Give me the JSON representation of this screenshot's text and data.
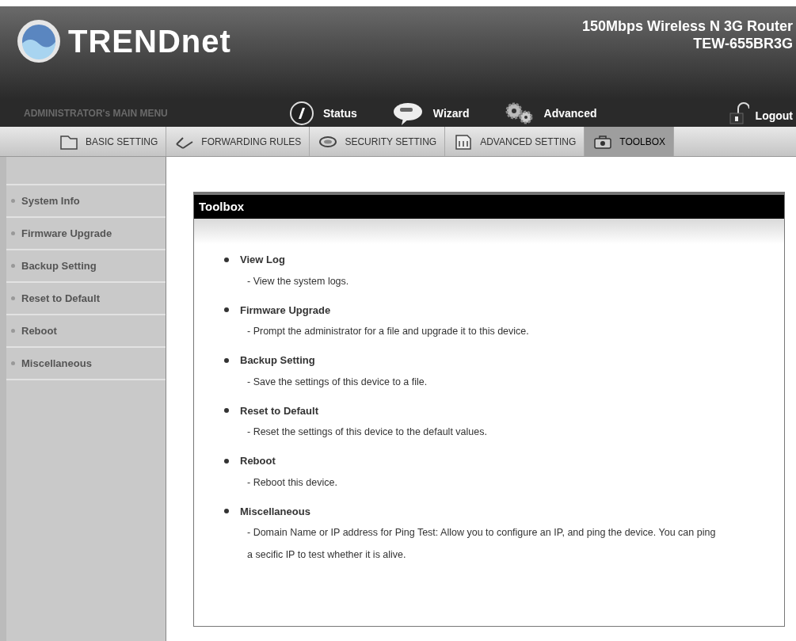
{
  "header": {
    "logo": "TRENDnet",
    "product": "150Mbps Wireless N 3G Router",
    "model": "TEW-655BR3G"
  },
  "main_menu": {
    "title": "ADMINISTRATOR's MAIN MENU",
    "items": [
      {
        "label": "Status",
        "kind": "status"
      },
      {
        "label": "Wizard",
        "kind": "wizard"
      },
      {
        "label": "Advanced",
        "kind": "advanced"
      }
    ],
    "logout": "Logout"
  },
  "tabs": [
    {
      "label": "BASIC SETTING",
      "kind": "basic",
      "selected": false
    },
    {
      "label": "FORWARDING RULES",
      "kind": "forwarding",
      "selected": false
    },
    {
      "label": "SECURITY SETTING",
      "kind": "security",
      "selected": false
    },
    {
      "label": "ADVANCED SETTING",
      "kind": "advanced",
      "selected": false
    },
    {
      "label": "TOOLBOX",
      "kind": "toolbox",
      "selected": true
    }
  ],
  "sidebar": {
    "items": [
      "System Info",
      "Firmware Upgrade",
      "Backup Setting",
      "Reset to Default",
      "Reboot",
      "Miscellaneous"
    ]
  },
  "panel": {
    "title": "Toolbox",
    "items": [
      {
        "title": "View Log",
        "description": "- View the system logs."
      },
      {
        "title": "Firmware Upgrade",
        "description": "- Prompt the administrator for a file and upgrade it to this device."
      },
      {
        "title": "Backup Setting",
        "description": "- Save the settings of this device to a file."
      },
      {
        "title": "Reset to Default",
        "description": "- Reset the settings of this device to the default values."
      },
      {
        "title": "Reboot",
        "description": "- Reboot this device."
      },
      {
        "title": "Miscellaneous",
        "description": "- Domain Name or IP address for Ping Test: Allow you to configure an IP, and ping the device. You can ping a secific IP to test whether it is alive."
      }
    ]
  }
}
